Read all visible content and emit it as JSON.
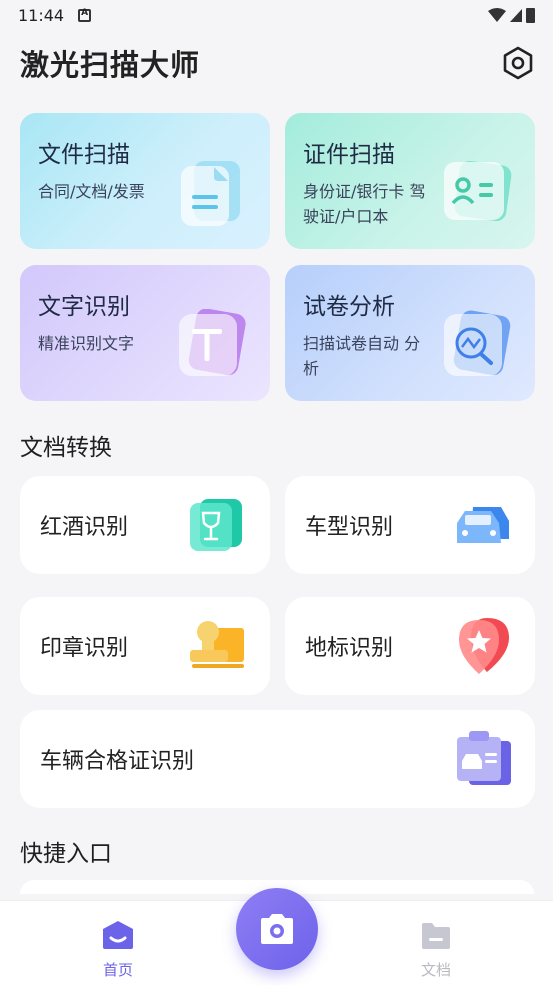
{
  "status_bar": {
    "time": "11:44"
  },
  "header": {
    "title": "激光扫描大师"
  },
  "feature_cards": [
    {
      "title": "文件扫描",
      "desc": "合同/文档/发票",
      "icon": "document-icon"
    },
    {
      "title": "证件扫描",
      "desc": "身份证/银行卡 驾驶证/户口本",
      "icon": "id-card-icon"
    },
    {
      "title": "文字识别",
      "desc": "精准识别文字",
      "icon": "text-t-icon"
    },
    {
      "title": "试卷分析",
      "desc": "扫描试卷自动 分析",
      "icon": "exam-analysis-icon"
    }
  ],
  "sections": {
    "doc_convert": "文档转换",
    "quick_entry": "快捷入口"
  },
  "tools": [
    {
      "label": "红酒识别",
      "icon": "wine-glass-icon"
    },
    {
      "label": "车型识别",
      "icon": "car-icon"
    },
    {
      "label": "印章识别",
      "icon": "stamp-icon"
    },
    {
      "label": "地标识别",
      "icon": "landmark-pin-icon"
    },
    {
      "label": "车辆合格证识别",
      "icon": "vehicle-certificate-icon"
    }
  ],
  "bottom_nav": {
    "home": "首页",
    "docs": "文档"
  },
  "colors": {
    "accent": "#6b63e8",
    "background": "#f5f5f7"
  }
}
